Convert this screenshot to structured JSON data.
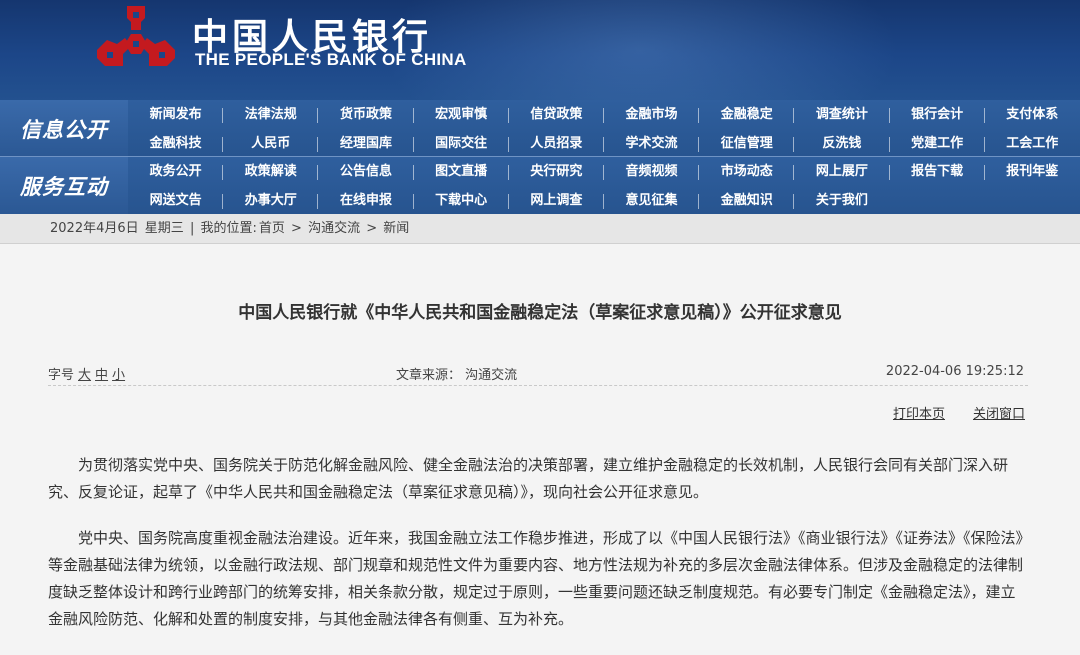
{
  "header": {
    "brand_cn": "中国人民银行",
    "brand_en": "THE PEOPLE'S BANK OF CHINA",
    "logo_icon": "pboc-logo-icon",
    "logo_color": "#c41a1f"
  },
  "nav": {
    "group1_label": "信息公开",
    "group2_label": "服务互动",
    "row1": [
      "新闻发布",
      "法律法规",
      "货币政策",
      "宏观审慎",
      "信贷政策",
      "金融市场",
      "金融稳定",
      "调查统计",
      "银行会计",
      "支付体系"
    ],
    "row2": [
      "金融科技",
      "人民币",
      "经理国库",
      "国际交往",
      "人员招录",
      "学术交流",
      "征信管理",
      "反洗钱",
      "党建工作",
      "工会工作"
    ],
    "row3": [
      "政务公开",
      "政策解读",
      "公告信息",
      "图文直播",
      "央行研究",
      "音频视频",
      "市场动态",
      "网上展厅",
      "报告下载",
      "报刊年鉴"
    ],
    "row4": [
      "网送文告",
      "办事大厅",
      "在线申报",
      "下载中心",
      "网上调查",
      "意见征集",
      "金融知识",
      "关于我们"
    ]
  },
  "breadcrumb": {
    "date": "2022年4月6日",
    "weekday": "星期三",
    "sep": "|",
    "location_label": "我的位置:",
    "home": "首页",
    "arrow": ">",
    "section": "沟通交流",
    "current": "新闻"
  },
  "article": {
    "title": "中国人民银行就《中华人民共和国金融稳定法（草案征求意见稿）》公开征求意见",
    "font_size_label": "字号",
    "font_large": "大",
    "font_medium": "中",
    "font_small": "小",
    "source": "文章来源：  沟通交流",
    "datetime": "2022-04-06 19:25:12",
    "print_label": "打印本页",
    "close_label": "关闭窗口",
    "paragraph1": "为贯彻落实党中央、国务院关于防范化解金融风险、健全金融法治的决策部署，建立维护金融稳定的长效机制，人民银行会同有关部门深入研究、反复论证，起草了《中华人民共和国金融稳定法（草案征求意见稿）》，现向社会公开征求意见。",
    "paragraph2": "党中央、国务院高度重视金融法治建设。近年来，我国金融立法工作稳步推进，形成了以《中国人民银行法》《商业银行法》《证券法》《保险法》等金融基础法律为统领，以金融行政法规、部门规章和规范性文件为重要内容、地方性法规为补充的多层次金融法律体系。但涉及金融稳定的法律制度缺乏整体设计和跨行业跨部门的统筹安排，相关条款分散，规定过于原则，一些重要问题还缺乏制度规范。有必要专门制定《金融稳定法》，建立金融风险防范、化解和处置的制度安排，与其他金融法律各有侧重、互为补充。"
  }
}
